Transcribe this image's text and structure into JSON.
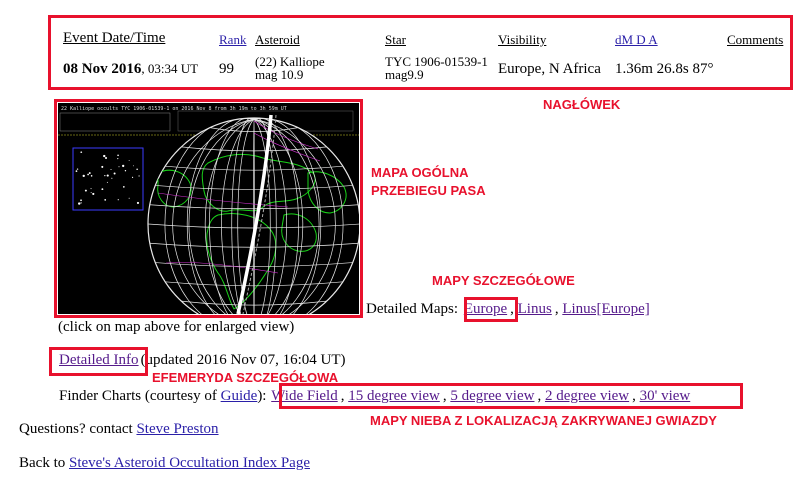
{
  "table": {
    "headers": {
      "date": "Event Date/Time",
      "rank": "Rank",
      "asteroid": "Asteroid",
      "star": "Star",
      "visibility": "Visibility",
      "dmda": "dM D A",
      "comments": "Comments"
    },
    "row": {
      "date": "08 Nov 2016",
      "time": ", 03:34 UT",
      "rank": "99",
      "asteroid_name": "(22) Kalliope",
      "asteroid_mag": "mag 10.9",
      "star_id": "TYC 1906-01539-1",
      "star_mag": "mag9.9",
      "visibility": "Europe, N Africa",
      "dmda": "1.36m 26.8s 87°"
    }
  },
  "map": {
    "header_text": "22 Kalliope occults TYC 1906-01539-1 on 2016 Nov 8 from 3h 19m to 3h 59m UT"
  },
  "click_hint": "(click on map above for enlarged view)",
  "detailed_maps": {
    "label": "Detailed Maps:",
    "europe": "Europe",
    "sep1": ",",
    "linus": "Linus",
    "sep2": ",",
    "linus_europe": "Linus[Europe]"
  },
  "detailed_info": {
    "link": "Detailed Info",
    "updated": "(updated 2016 Nov 07, 16:04 UT)"
  },
  "finder": {
    "prefix": "Finder Charts (courtesy of ",
    "guide": "Guide",
    "suffix": "):",
    "links": [
      "Wide Field",
      "15 degree view",
      "5 degree view",
      "2 degree view",
      "30' view"
    ],
    "sep": ","
  },
  "questions": {
    "text": "Questions? contact ",
    "link": "Steve Preston"
  },
  "back": {
    "text": "Back to ",
    "link": "Steve's Asteroid Occultation Index Page"
  },
  "annotations": {
    "naglowek": "NAGŁÓWEK",
    "mapa_line1": "MAPA OGÓLNA",
    "mapa_line2": "PRZEBIEGU PASA",
    "mapy_szcz": "MAPY SZCZEGÓŁOWE",
    "efemeryda": "EFEMERYDA SZCZEGÓŁOWA",
    "mapy_nieba": "MAPY NIEBA Z LOKALIZACJĄ ZAKRYWANEJ GWIAZDY"
  },
  "colors": {
    "annotation_red": "#e8112d",
    "link_blue": "#2a1fa8",
    "link_visited": "#551a8b",
    "map_grid": "#e8e8e8",
    "map_land": "#19d219"
  }
}
